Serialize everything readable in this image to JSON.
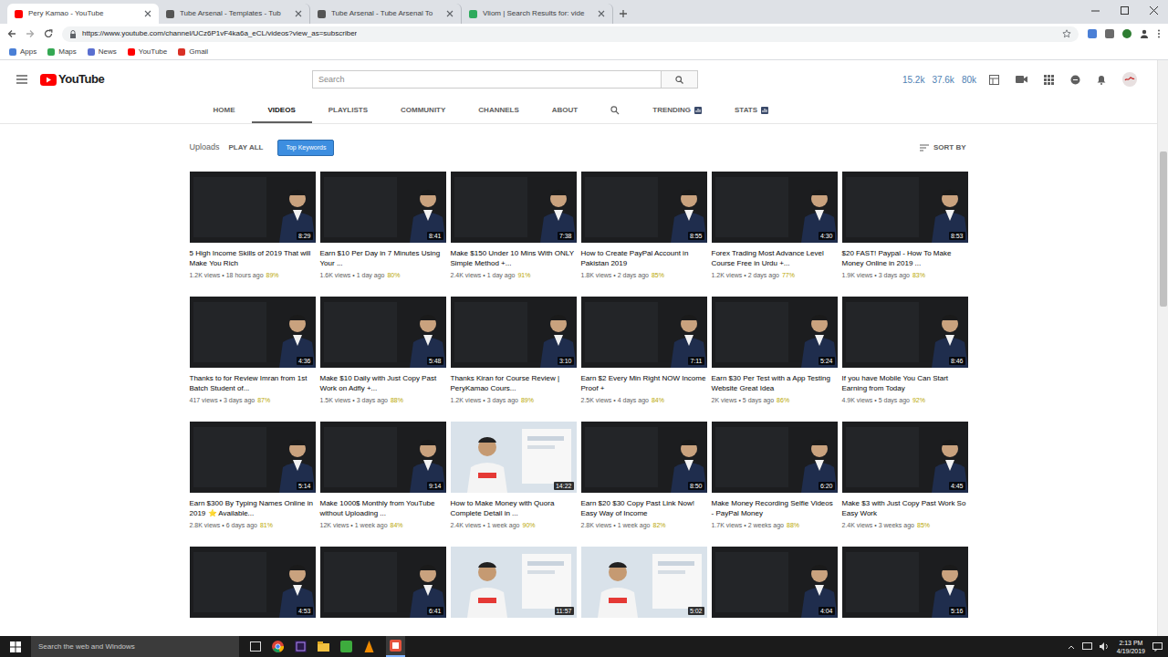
{
  "browser": {
    "tabs": [
      {
        "label": "Pery Kamao - YouTube",
        "selected": true,
        "color": "#ff0000"
      },
      {
        "label": "Tube Arsenal - Templates - Tub",
        "selected": false,
        "color": "#555555"
      },
      {
        "label": "Tube Arsenal - Tube Arsenal To",
        "selected": false,
        "color": "#555555"
      },
      {
        "label": "Vliom | Search Results for: vide",
        "selected": false,
        "color": "#2eaa5c"
      }
    ],
    "url": "https://www.youtube.com/channel/UCz6P1vF4ka6a_eCL/videos?view_as=subscriber",
    "bookmarks": [
      {
        "label": "Apps",
        "color": "#4a7fd6"
      },
      {
        "label": "Maps",
        "color": "#34a853"
      },
      {
        "label": "News",
        "color": "#5a6fd0"
      },
      {
        "label": "YouTube",
        "color": "#ff0000"
      },
      {
        "label": "Gmail",
        "color": "#d93025"
      }
    ]
  },
  "youtube": {
    "logo": "YouTube",
    "search": {
      "placeholder": "Search"
    },
    "stats": [
      "15.2k",
      "37.6k",
      "80k"
    ],
    "nav": [
      {
        "label": "HOME",
        "kind": "tab",
        "selected": false
      },
      {
        "label": "VIDEOS",
        "kind": "tab",
        "selected": true
      },
      {
        "label": "PLAYLISTS",
        "kind": "tab",
        "selected": false
      },
      {
        "label": "COMMUNITY",
        "kind": "tab",
        "selected": false
      },
      {
        "label": "CHANNELS",
        "kind": "tab",
        "selected": false
      },
      {
        "label": "ABOUT",
        "kind": "tab",
        "selected": false
      },
      {
        "kind": "search",
        "selected": false
      },
      {
        "label": "TRENDING",
        "kind": "tool",
        "selected": false
      },
      {
        "label": "STATS",
        "kind": "tool",
        "selected": false
      }
    ]
  },
  "uploads": {
    "title": "Uploads",
    "play_all": "PLAY ALL",
    "keywords_button": "Top Keywords",
    "sort": "SORT BY"
  },
  "videos": [
    {
      "title": "5 High Income Skills of 2019 That will Make You Rich",
      "meta": "1.2K views • 18 hours ago",
      "score": "89%",
      "duration": "8:29",
      "kind": "graphic"
    },
    {
      "title": "Earn $10 Per Day in 7 Minutes Using Your ...",
      "meta": "1.6K views • 1 day ago",
      "score": "80%",
      "duration": "8:41",
      "kind": "graphic"
    },
    {
      "title": "Make $150 Under 10 Mins With ONLY Simple Method +...",
      "meta": "2.4K views • 1 day ago",
      "score": "91%",
      "duration": "7:38",
      "kind": "graphic"
    },
    {
      "title": "How to Create PayPal Account in Pakistan 2019",
      "meta": "1.8K views • 2 days ago",
      "score": "85%",
      "duration": "8:55",
      "kind": "graphic"
    },
    {
      "title": "Forex Trading Most Advance Level Course Free in Urdu +...",
      "meta": "1.2K views • 2 days ago",
      "score": "77%",
      "duration": "4:30",
      "kind": "graphic"
    },
    {
      "title": "$20 FAST! Paypal - How To Make Money Online in 2019 ...",
      "meta": "1.9K views • 3 days ago",
      "score": "83%",
      "duration": "8:53",
      "kind": "graphic"
    },
    {
      "title": "Thanks to for Review Imran from 1st Batch Student of...",
      "meta": "417 views • 3 days ago",
      "score": "87%",
      "duration": "4:36",
      "kind": "graphic"
    },
    {
      "title": "Make $10 Daily with Just Copy Past Work on Adfly +...",
      "meta": "1.5K views • 3 days ago",
      "score": "88%",
      "duration": "5:48",
      "kind": "graphic"
    },
    {
      "title": "Thanks Kiran for Course Review | PeryKamao Cours...",
      "meta": "1.2K views • 3 days ago",
      "score": "89%",
      "duration": "3:10",
      "kind": "graphic"
    },
    {
      "title": "Earn $2 Every Min Right NOW Income Proof +",
      "meta": "2.5K views • 4 days ago",
      "score": "84%",
      "duration": "7:11",
      "kind": "graphic"
    },
    {
      "title": "Earn $30 Per Test with a App Testing Website Great Idea",
      "meta": "2K views • 5 days ago",
      "score": "86%",
      "duration": "5:24",
      "kind": "graphic"
    },
    {
      "title": "If you have Mobile You Can Start Earning from Today",
      "meta": "4.9K views • 5 days ago",
      "score": "92%",
      "duration": "8:46",
      "kind": "graphic"
    },
    {
      "title": "Earn $300 By Typing Names Online in 2019 ⭐ Available...",
      "meta": "2.8K views • 6 days ago",
      "score": "81%",
      "duration": "5:14",
      "kind": "graphic"
    },
    {
      "title": "Make 1000$ Monthly from YouTube without Uploading ...",
      "meta": "12K views • 1 week ago",
      "score": "84%",
      "duration": "9:14",
      "kind": "graphic"
    },
    {
      "title": "How to Make Money with Quora Complete Detail in ...",
      "meta": "2.4K views • 1 week ago",
      "score": "90%",
      "duration": "14:22",
      "kind": "photo"
    },
    {
      "title": "Earn $20 $30 Copy Past Link Now! Easy Way of Income",
      "meta": "2.8K views • 1 week ago",
      "score": "82%",
      "duration": "8:50",
      "kind": "graphic"
    },
    {
      "title": "Make Money Recording Selfie Videos - PayPal Money",
      "meta": "1.7K views • 2 weeks ago",
      "score": "88%",
      "duration": "6:20",
      "kind": "graphic"
    },
    {
      "title": "Make $3 with Just Copy Past Work So Easy Work",
      "meta": "2.4K views • 3 weeks ago",
      "score": "85%",
      "duration": "4:45",
      "kind": "graphic"
    },
    {
      "duration": "4:53",
      "kind": "graphic"
    },
    {
      "duration": "6:41",
      "kind": "graphic"
    },
    {
      "duration": "11:57",
      "kind": "photo"
    },
    {
      "duration": "5:02",
      "kind": "photo"
    },
    {
      "duration": "4:04",
      "kind": "graphic"
    },
    {
      "duration": "5:16",
      "kind": "graphic"
    }
  ],
  "taskbar": {
    "search": "Search the web and Windows",
    "time": "2:13 PM",
    "date": "4/19/2019"
  }
}
